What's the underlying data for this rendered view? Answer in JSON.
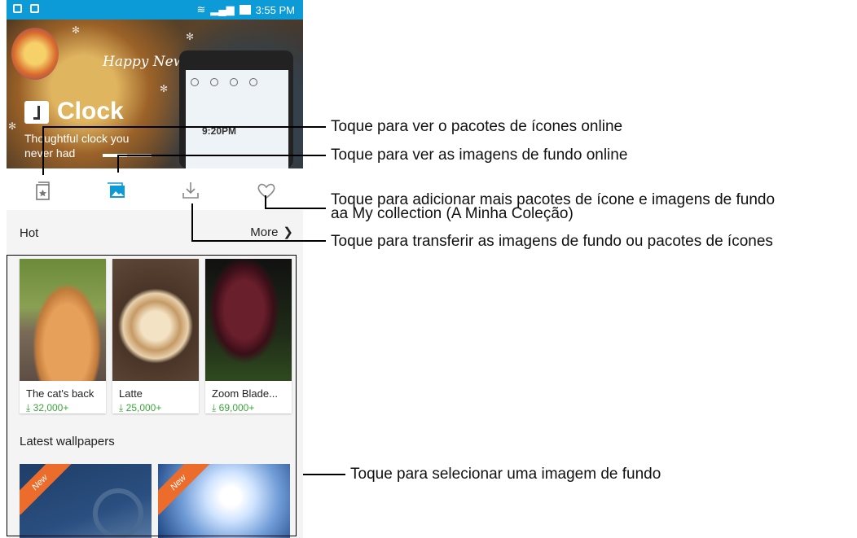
{
  "status_bar": {
    "time": "3:55 PM",
    "color": "#0d9bd8"
  },
  "banner": {
    "greeting": "Happy New Year",
    "app_name": "Clock",
    "tagline": "Thoughtful clock you never had",
    "screen_time": "9:20PM"
  },
  "tabs": [
    {
      "icon": "themes-icon",
      "active": false
    },
    {
      "icon": "wallpaper-icon",
      "active": true
    },
    {
      "icon": "download-icon",
      "active": false
    },
    {
      "icon": "heart-icon",
      "active": false
    }
  ],
  "hot": {
    "label": "Hot",
    "more_label": "More"
  },
  "hot_items": [
    {
      "name": "The cat's back",
      "downloads": "32,000+"
    },
    {
      "name": "Latte",
      "downloads": "25,000+"
    },
    {
      "name": "Zoom Blade...",
      "downloads": "69,000+"
    }
  ],
  "latest": {
    "label": "Latest wallpapers",
    "badge": "New"
  },
  "callouts": {
    "themes": "Toque para ver o pacotes de ícones online",
    "wallpapers": "Toque para ver as imagens de fundo online",
    "collection_line1": "Toque para adicionar mais pacotes de ícone e imagens de fundo",
    "collection_line2": "aa My collection (A Minha Coleção)",
    "download": "Toque para transferir as imagens de fundo ou pacotes de ícones",
    "select": "Toque para selecionar uma imagem de fundo"
  },
  "colors": {
    "accent": "#0d9bd8",
    "download_green": "#3aa63a",
    "new_ribbon": "#ec6d2b"
  }
}
